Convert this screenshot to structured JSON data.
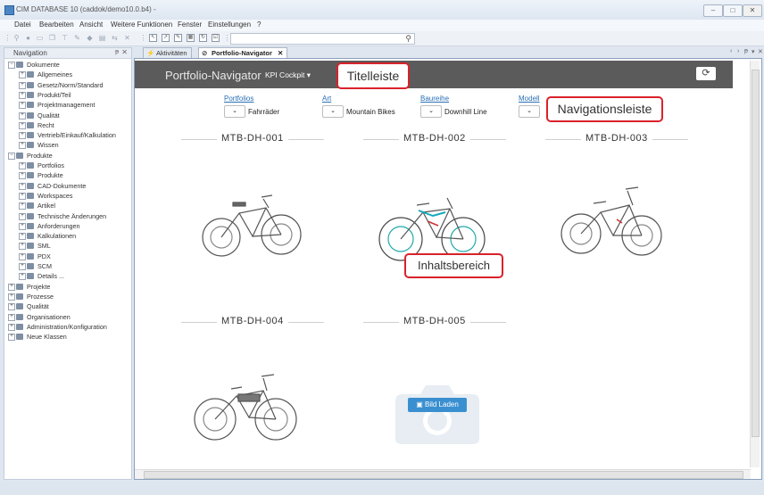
{
  "window": {
    "title": "CIM DATABASE 10 (caddok/demo10.0.b4) -",
    "min": "–",
    "max": "□",
    "close": "✕"
  },
  "menu": [
    "Datei",
    "Bearbeiten",
    "Ansicht",
    "Weitere Funktionen",
    "Fenster",
    "Einstellungen",
    "?"
  ],
  "navigation": {
    "title": "Navigation",
    "pin": "ᵽ",
    "close": "✕",
    "tree": [
      {
        "label": "Dokumente",
        "level": 0,
        "expanded": true
      },
      {
        "label": "Allgemeines",
        "level": 1
      },
      {
        "label": "Gesetz/Norm/Standard",
        "level": 1
      },
      {
        "label": "Produkt/Teil",
        "level": 1
      },
      {
        "label": "Projektmanagement",
        "level": 1
      },
      {
        "label": "Qualität",
        "level": 1
      },
      {
        "label": "Recht",
        "level": 1
      },
      {
        "label": "Vertrieb/Einkauf/Kalkulation",
        "level": 1
      },
      {
        "label": "Wissen",
        "level": 1
      },
      {
        "label": "Produkte",
        "level": 0,
        "expanded": true
      },
      {
        "label": "Portfolios",
        "level": 1
      },
      {
        "label": "Produkte",
        "level": 1
      },
      {
        "label": "CAD-Dokumente",
        "level": 1
      },
      {
        "label": "Workspaces",
        "level": 1
      },
      {
        "label": "Artikel",
        "level": 1
      },
      {
        "label": "Technische Änderungen",
        "level": 1
      },
      {
        "label": "Anforderungen",
        "level": 1
      },
      {
        "label": "Kalkulationen",
        "level": 1
      },
      {
        "label": "SML",
        "level": 1
      },
      {
        "label": "PDX",
        "level": 1
      },
      {
        "label": "SCM",
        "level": 1
      },
      {
        "label": "Details ...",
        "level": 1
      },
      {
        "label": "Projekte",
        "level": 0
      },
      {
        "label": "Prozesse",
        "level": 0
      },
      {
        "label": "Qualität",
        "level": 0
      },
      {
        "label": "Organisationen",
        "level": 0
      },
      {
        "label": "Administration/Konfiguration",
        "level": 0
      },
      {
        "label": "Neue Klassen",
        "level": 0
      }
    ]
  },
  "tabs": [
    {
      "label": "Aktivitäten"
    },
    {
      "label": "Portfolio-Navigator",
      "active": true,
      "close": "✕"
    }
  ],
  "portfolio": {
    "title": "Portfolio-Navigator",
    "kpi": "KPI Cockpit ▾",
    "refresh_icon": "⟳",
    "filters": [
      {
        "caption": "Portfolios",
        "value": "Fahrräder"
      },
      {
        "caption": "Art",
        "value": "Mountain Bikes"
      },
      {
        "caption": "Baureihe",
        "value": "Downhill Line"
      },
      {
        "caption": "Modell",
        "value": ""
      }
    ],
    "cards": [
      "MTB-DH-001",
      "MTB-DH-002",
      "MTB-DH-003",
      "MTB-DH-004",
      "MTB-DH-005"
    ],
    "bild_laden": "Bild Laden"
  },
  "callouts": {
    "titelleiste": "Titelleiste",
    "navigationsleiste": "Navigationsleiste",
    "inhaltsbereich": "Inhaltsbereich"
  },
  "colors": {
    "header_bg": "#5b5b5b",
    "callout_border": "#d9222a",
    "link": "#2a6fb5",
    "button": "#3a8fd0"
  }
}
